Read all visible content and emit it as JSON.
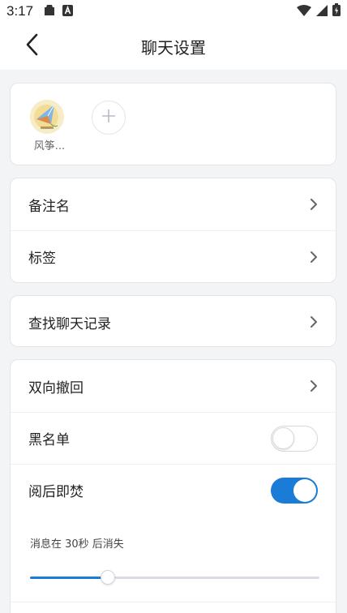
{
  "status_bar": {
    "time": "3:17",
    "icons": [
      "notification-icon",
      "app-icon",
      "wifi-icon",
      "signal-icon",
      "battery-icon"
    ]
  },
  "header": {
    "title": "聊天设置",
    "back_icon": "back-arrow-icon"
  },
  "members": {
    "items": [
      {
        "name": "风筝..."
      }
    ],
    "add_icon": "plus-icon"
  },
  "group1": {
    "items": [
      {
        "label": "备注名"
      },
      {
        "label": "标签"
      }
    ]
  },
  "group2": {
    "items": [
      {
        "label": "查找聊天记录"
      }
    ]
  },
  "group3": {
    "recall_label": "双向撤回",
    "blacklist_label": "黑名单",
    "blacklist_on": false,
    "burn_label": "阅后即焚",
    "burn_on": true,
    "burn_desc": "消息在 30秒 后消失",
    "burn_slider_fraction": 0.27
  },
  "colors": {
    "accent": "#1a7cd6",
    "background": "#f3f4f6"
  }
}
